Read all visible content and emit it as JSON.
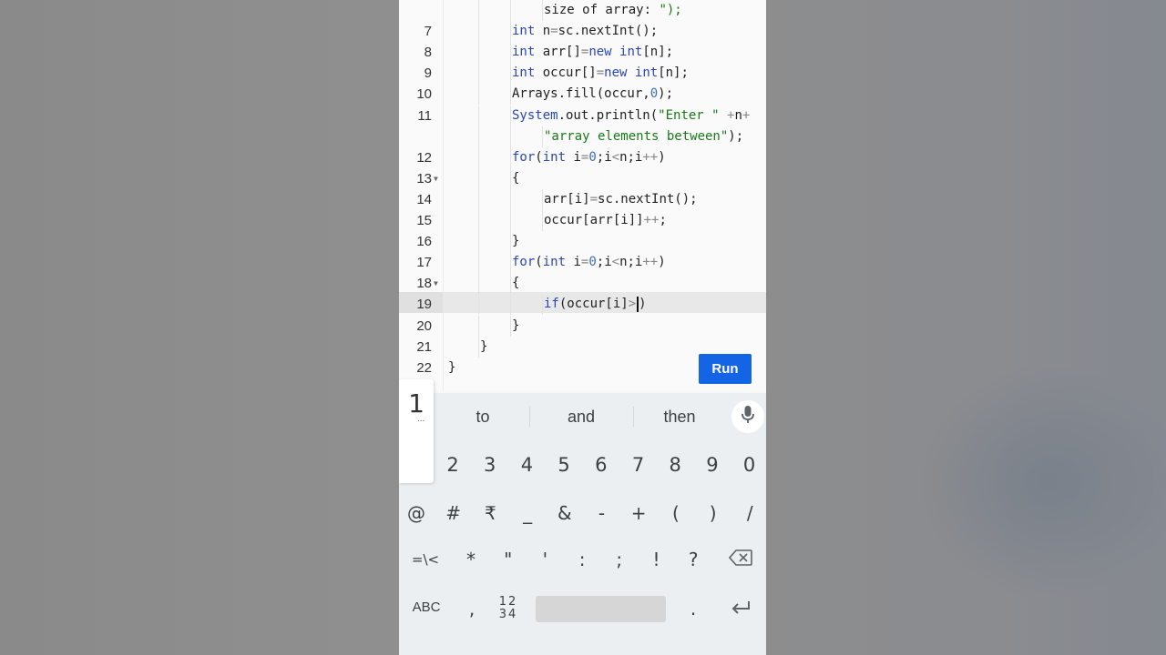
{
  "editor": {
    "lines": [
      {
        "num": "",
        "text": "size of array: \");",
        "indent": 2
      },
      {
        "num": "7",
        "text": "int n=sc.nextInt();",
        "indent": 1
      },
      {
        "num": "8",
        "text": "int arr[]=new int[n];",
        "indent": 1
      },
      {
        "num": "9",
        "text": "int occur[]=new int[n];",
        "indent": 1
      },
      {
        "num": "10",
        "text": "Arrays.fill(occur,0);",
        "indent": 1
      },
      {
        "num": "11",
        "text": "System.out.println(\"Enter \" +n+",
        "indent": 1
      },
      {
        "num": "",
        "text": "\"array elements between\");",
        "indent": 2
      },
      {
        "num": "12",
        "text": "for(int i=0;i<n;i++)",
        "indent": 1
      },
      {
        "num": "13",
        "text": "{",
        "indent": 1,
        "fold": true
      },
      {
        "num": "14",
        "text": "arr[i]=sc.nextInt();",
        "indent": 2
      },
      {
        "num": "15",
        "text": "occur[arr[i]]++;",
        "indent": 2
      },
      {
        "num": "16",
        "text": "}",
        "indent": 1
      },
      {
        "num": "17",
        "text": "for(int i=0;i<n;i++)",
        "indent": 1
      },
      {
        "num": "18",
        "text": "{",
        "indent": 1,
        "fold": true
      },
      {
        "num": "19",
        "text": "if(occur[i]>)",
        "indent": 2,
        "active": true
      },
      {
        "num": "20",
        "text": "}",
        "indent": 1
      },
      {
        "num": "21",
        "text": "}",
        "indent": 0
      },
      {
        "num": "22",
        "text": "}",
        "indent": -1
      }
    ],
    "run_label": "Run"
  },
  "keyboard": {
    "suggestions": [
      "to",
      "and",
      "then"
    ],
    "mic_icon": "mic-icon",
    "popup_digit": "1",
    "popup_more": "...",
    "digit_row": [
      "2",
      "3",
      "4",
      "5",
      "6",
      "7",
      "8",
      "9",
      "0"
    ],
    "symbol_row": [
      "@",
      "#",
      "₹",
      "_",
      "&",
      "-",
      "+",
      "(",
      ")",
      "/"
    ],
    "punct_row": [
      "=\\<",
      "*",
      "\"",
      "'",
      ":",
      ";",
      "!",
      "?"
    ],
    "backspace_icon": "backspace-icon",
    "abc_label": "ABC",
    "comma_label": ",",
    "numpad_label_top": "12",
    "numpad_label_bottom": "34",
    "period_label": ".",
    "enter_icon": "enter-icon"
  }
}
